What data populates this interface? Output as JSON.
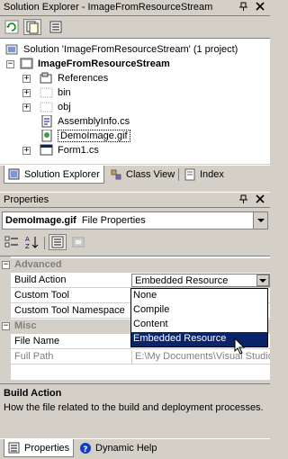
{
  "solution_explorer": {
    "title": "Solution Explorer - ImageFromResourceStream",
    "pin_glyph": "↕",
    "close_glyph": "×",
    "tree": {
      "solution_label": "Solution 'ImageFromResourceStream' (1 project)",
      "project_label": "ImageFromResourceStream",
      "items": [
        {
          "label": "References",
          "icon": "references-icon",
          "expander": "+"
        },
        {
          "label": "bin",
          "icon": "folder-icon",
          "expander": "+"
        },
        {
          "label": "obj",
          "icon": "folder-icon",
          "expander": "+"
        },
        {
          "label": "AssemblyInfo.cs",
          "icon": "cs-file-icon",
          "expander": ""
        },
        {
          "label": "DemoImage.gif",
          "icon": "image-file-icon",
          "expander": ""
        },
        {
          "label": "Form1.cs",
          "icon": "form-file-icon",
          "expander": "+"
        }
      ]
    },
    "tabs": [
      "Solution Explorer",
      "Class View",
      "Index"
    ]
  },
  "properties": {
    "title": "Properties",
    "pin_glyph": "↕",
    "close_glyph": "×",
    "object_name": "DemoImage.gif",
    "object_type": "File Properties",
    "categories": {
      "advanced": "Advanced",
      "misc": "Misc"
    },
    "rows": {
      "build_action": {
        "name": "Build Action",
        "value": "Embedded Resource"
      },
      "custom_tool": {
        "name": "Custom Tool",
        "value": ""
      },
      "custom_tool_namespace": {
        "name": "Custom Tool Namespace",
        "value": ""
      },
      "file_name": {
        "name": "File Name",
        "value": ""
      },
      "full_path": {
        "name": "Full Path",
        "value": "E:\\My Documents\\Visual Studio"
      }
    },
    "dropdown_options": [
      "None",
      "Compile",
      "Content",
      "Embedded Resource"
    ],
    "dropdown_selected": "Embedded Resource",
    "description": {
      "title": "Build Action",
      "text": "How the file related to the build and deployment processes."
    },
    "tabs": [
      "Properties",
      "Dynamic Help"
    ]
  },
  "colors": {
    "chrome": "#d4d0c8",
    "selection": "#0a246a",
    "border": "#808080"
  }
}
